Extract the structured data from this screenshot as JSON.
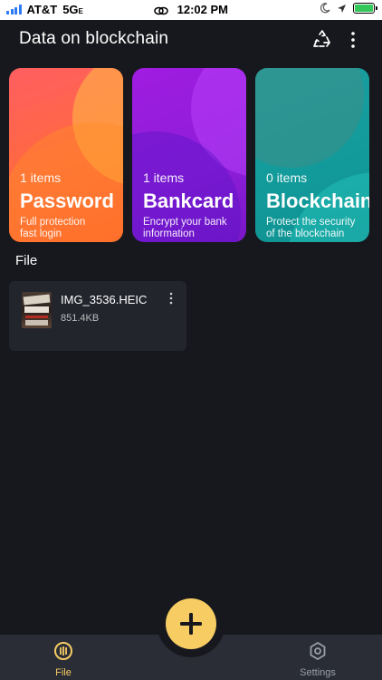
{
  "status_bar": {
    "carrier": "AT&T",
    "network": "5G",
    "network_suffix": "E",
    "time": "12:02 PM"
  },
  "header": {
    "title": "Data on blockchain"
  },
  "cards": [
    {
      "count": "1 items",
      "name": "Password",
      "desc_line1": "Full protection",
      "desc_line2": "fast login"
    },
    {
      "count": "1 items",
      "name": "Bankcard",
      "desc_line1": "Encrypt your bank",
      "desc_line2": "information"
    },
    {
      "count": "0 items",
      "name": "Blockchain",
      "desc_line1": "Protect the security",
      "desc_line2": "of the blockchain"
    }
  ],
  "file_section": {
    "title": "File",
    "items": [
      {
        "name": "IMG_3536.HEIC",
        "size": "851.4KB"
      }
    ]
  },
  "bottom_nav": {
    "file_label": "File",
    "settings_label": "Settings"
  },
  "colors": {
    "background": "#17181d",
    "accent": "#f7cc63",
    "password_card": "#ff6a3d",
    "bankcard_card": "#8d1ed8",
    "blockchain_card": "#129a9a"
  }
}
